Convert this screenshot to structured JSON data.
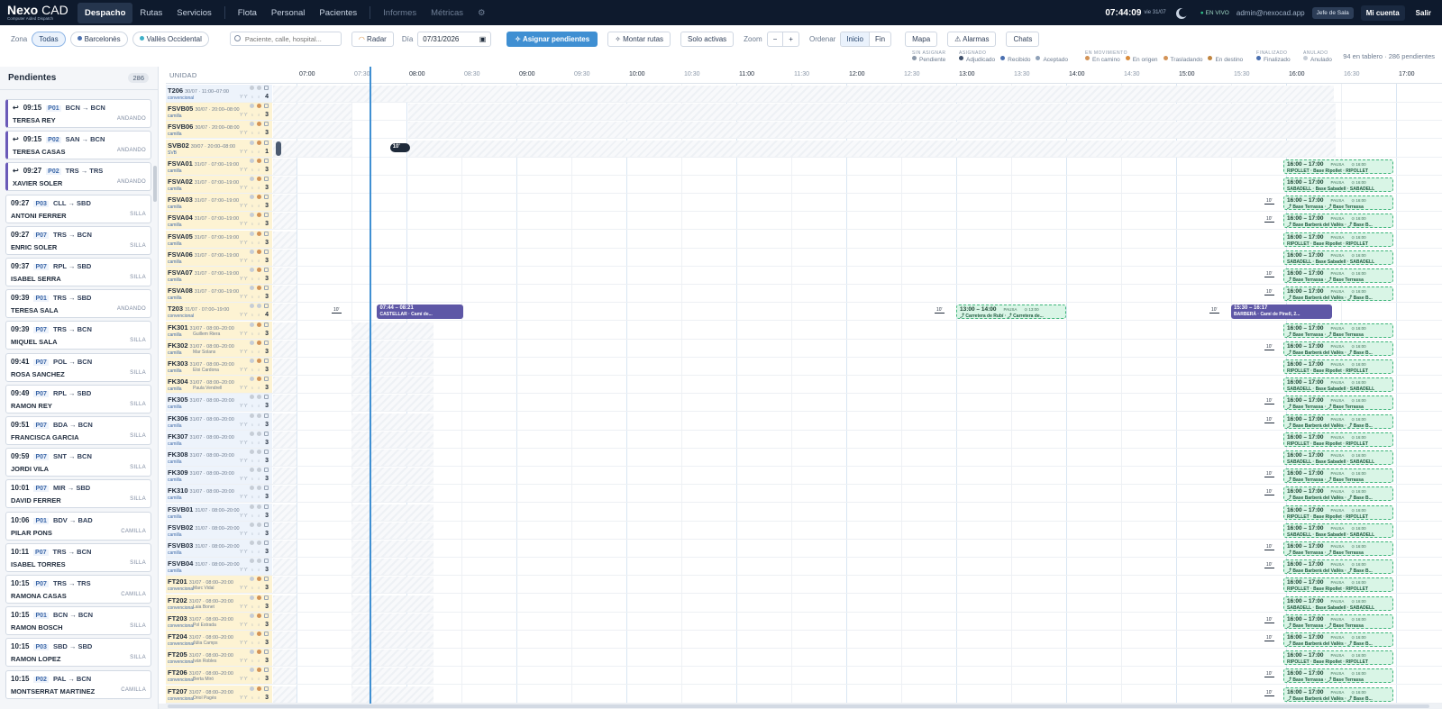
{
  "brand": {
    "name_bold": "Nexo",
    "name_light": " CAD",
    "subtitle": "Computer Aided Dispatch"
  },
  "nav": {
    "tabs": [
      {
        "label": "Despacho",
        "active": true
      },
      {
        "label": "Rutas"
      },
      {
        "label": "Servicios"
      },
      {
        "label": "Flota"
      },
      {
        "label": "Personal"
      },
      {
        "label": "Pacientes"
      },
      {
        "label": "Informes",
        "dim": true
      },
      {
        "label": "Métricas",
        "dim": true
      }
    ],
    "clock": "07:44:09",
    "date": "vie 31/07",
    "live": "EN VIVO",
    "user_email": "admin@nexocad.app",
    "role": "Jefe de Sala",
    "account": "Mi cuenta",
    "logout": "Salir"
  },
  "filters": {
    "zone_label": "Zona",
    "zones": [
      {
        "label": "Todas",
        "active": true
      },
      {
        "label": "Barcelonès",
        "color": "#4a6fb0"
      },
      {
        "label": "Vallès Occidental",
        "color": "#3fb0c8"
      }
    ],
    "search_placeholder": "Paciente, calle, hospital...",
    "radar": "Radar",
    "day_label": "Día",
    "date_value": "07/31/2026",
    "assign": "Asignar pendientes",
    "routes": "Montar rutas",
    "only_active": "Solo activas",
    "zoom_label": "Zoom",
    "zoom_minus": "−",
    "zoom_plus": "+",
    "order_label": "Ordenar",
    "order_start": "Inicio",
    "order_end": "Fin",
    "map": "Mapa",
    "alarms": "Alarmas",
    "chats": "Chats"
  },
  "legend": {
    "groups": [
      {
        "head": "SIN ASIGNAR",
        "items": [
          {
            "label": "Pendiente",
            "color": "#8a97a8"
          }
        ]
      },
      {
        "head": "ASIGNADO",
        "items": [
          {
            "label": "Adjudicado",
            "color": "#3e4f6a"
          },
          {
            "label": "Recibido",
            "color": "#4a6fb0"
          },
          {
            "label": "Aceptado",
            "color": "#8fa1b8"
          }
        ]
      },
      {
        "head": "EN MOVIMIENTO",
        "items": [
          {
            "label": "En camino",
            "color": "#d39357"
          },
          {
            "label": "En origen",
            "color": "#d98b3a"
          },
          {
            "label": "Trasladando",
            "color": "#d39357"
          },
          {
            "label": "En destino",
            "color": "#c0843f"
          }
        ]
      },
      {
        "head": "FINALIZADO",
        "items": [
          {
            "label": "Finalizado",
            "color": "#4a6fb0"
          }
        ]
      },
      {
        "head": "ANULADO",
        "items": [
          {
            "label": "Anulado",
            "color": "#c6cdd6"
          }
        ]
      }
    ],
    "counts": "94 en tablero · 286 pendientes"
  },
  "pending": {
    "title": "Pendientes",
    "count": "286",
    "cards": [
      {
        "time": "09:15",
        "prio": "P01",
        "route": "BCN → BCN",
        "name": "TERESA REY",
        "mode": "ANDANDO",
        "ret": true
      },
      {
        "time": "09:15",
        "prio": "P02",
        "route": "SAN → BCN",
        "name": "TERESA CASAS",
        "mode": "ANDANDO",
        "ret": true
      },
      {
        "time": "09:27",
        "prio": "P02",
        "route": "TRS → TRS",
        "name": "XAVIER SOLER",
        "mode": "ANDANDO",
        "ret": true
      },
      {
        "time": "09:27",
        "prio": "P03",
        "route": "CLL → SBD",
        "name": "ANTONI FERRER",
        "mode": "SILLA"
      },
      {
        "time": "09:27",
        "prio": "P07",
        "route": "TRS → BCN",
        "name": "ENRIC SOLER",
        "mode": "SILLA"
      },
      {
        "time": "09:37",
        "prio": "P07",
        "route": "RPL → SBD",
        "name": "ISABEL SERRA",
        "mode": "SILLA"
      },
      {
        "time": "09:39",
        "prio": "P01",
        "route": "TRS → SBD",
        "name": "TERESA SALA",
        "mode": "ANDANDO"
      },
      {
        "time": "09:39",
        "prio": "P07",
        "route": "TRS → BCN",
        "name": "MIQUEL SALA",
        "mode": "SILLA"
      },
      {
        "time": "09:41",
        "prio": "P07",
        "route": "POL → BCN",
        "name": "ROSA SANCHEZ",
        "mode": "SILLA"
      },
      {
        "time": "09:49",
        "prio": "P07",
        "route": "RPL → SBD",
        "name": "RAMON REY",
        "mode": "SILLA"
      },
      {
        "time": "09:51",
        "prio": "P07",
        "route": "BDA → BCN",
        "name": "FRANCISCA GARCIA",
        "mode": "SILLA"
      },
      {
        "time": "09:59",
        "prio": "P07",
        "route": "SNT → BCN",
        "name": "JORDI VILA",
        "mode": "SILLA"
      },
      {
        "time": "10:01",
        "prio": "P07",
        "route": "MIR → SBD",
        "name": "DAVID FERRER",
        "mode": "SILLA"
      },
      {
        "time": "10:06",
        "prio": "P01",
        "route": "BDV → BAD",
        "name": "PILAR PONS",
        "mode": "CAMILLA"
      },
      {
        "time": "10:11",
        "prio": "P07",
        "route": "TRS → BCN",
        "name": "ISABEL TORRES",
        "mode": "SILLA"
      },
      {
        "time": "10:15",
        "prio": "P07",
        "route": "TRS → TRS",
        "name": "RAMONA CASAS",
        "mode": "CAMILLA"
      },
      {
        "time": "10:15",
        "prio": "P01",
        "route": "BCN → BCN",
        "name": "RAMON BOSCH",
        "mode": "SILLA"
      },
      {
        "time": "10:15",
        "prio": "P03",
        "route": "SBD → SBD",
        "name": "RAMON LOPEZ",
        "mode": "SILLA"
      },
      {
        "time": "10:15",
        "prio": "P02",
        "route": "PAL → BCN",
        "name": "MONTSERRAT MARTINEZ",
        "mode": "CAMILLA"
      }
    ]
  },
  "timeline": {
    "unit_header": "UNIDAD",
    "ticks": [
      "07:00",
      "07:30",
      "08:00",
      "08:30",
      "09:00",
      "09:30",
      "10:00",
      "10:30",
      "11:00",
      "11:30",
      "12:00",
      "12:30",
      "13:00",
      "13:30",
      "14:00",
      "14:30",
      "15:00",
      "15:30",
      "16:00",
      "16:30",
      "17:00"
    ],
    "rows": [
      {
        "code": "T206",
        "shift": "30/07 · 11:00–07:00",
        "sub": "convencional",
        "num": "4",
        "bg": "blue"
      },
      {
        "code": "FSVB05",
        "shift": "30/07 · 20:00–08:00",
        "sub": "camilla",
        "num": "3",
        "bg": "yellow"
      },
      {
        "code": "FSVB06",
        "shift": "30/07 · 20:00–08:00",
        "sub": "camilla",
        "num": "3",
        "bg": "yellow"
      },
      {
        "code": "SVB02",
        "shift": "30/07 · 20:00–08:00",
        "sub": "SVB",
        "num": "1",
        "bg": "yellow"
      },
      {
        "code": "FSVA01",
        "shift": "31/07 · 07:00–19:00",
        "sub": "camilla",
        "num": "3",
        "bg": "yellow",
        "block": "ripollet"
      },
      {
        "code": "FSVA02",
        "shift": "31/07 · 07:00–19:00",
        "sub": "camilla",
        "num": "3",
        "bg": "yellow",
        "block": "sabadell"
      },
      {
        "code": "FSVA03",
        "shift": "31/07 · 07:00–19:00",
        "sub": "camilla",
        "num": "3",
        "bg": "yellow",
        "block": "terrassa",
        "gap": true
      },
      {
        "code": "FSVA04",
        "shift": "31/07 · 07:00–19:00",
        "sub": "camilla",
        "num": "3",
        "bg": "yellow",
        "block": "barbera",
        "gap": true
      },
      {
        "code": "FSVA05",
        "shift": "31/07 · 07:00–19:00",
        "sub": "camilla",
        "num": "3",
        "bg": "yellow",
        "block": "ripollet"
      },
      {
        "code": "FSVA06",
        "shift": "31/07 · 07:00–19:00",
        "sub": "camilla",
        "num": "3",
        "bg": "yellow",
        "block": "sabadell"
      },
      {
        "code": "FSVA07",
        "shift": "31/07 · 07:00–19:00",
        "sub": "camilla",
        "num": "3",
        "bg": "yellow",
        "block": "terrassa",
        "gap": true
      },
      {
        "code": "FSVA08",
        "shift": "31/07 · 07:00–19:00",
        "sub": "camilla",
        "num": "3",
        "bg": "yellow",
        "block": "barbera",
        "gap": true
      },
      {
        "code": "T203",
        "shift": "31/07 · 07:00–19:00",
        "sub": "convencional",
        "num": "4",
        "bg": "yellow",
        "special": true
      },
      {
        "code": "FK301",
        "shift": "31/07 · 08:00–20:00",
        "sub": "camilla",
        "crew": "Guillem Riera",
        "num": "3",
        "bg": "yellow",
        "block": "terrassa"
      },
      {
        "code": "FK302",
        "shift": "31/07 · 08:00–20:00",
        "sub": "camilla",
        "crew": "Mar Solans",
        "num": "3",
        "bg": "yellow",
        "block": "barbera",
        "gap": true
      },
      {
        "code": "FK303",
        "shift": "31/07 · 08:00–20:00",
        "sub": "camilla",
        "crew": "Eloi Cardona",
        "num": "3",
        "bg": "yellow",
        "block": "ripollet"
      },
      {
        "code": "FK304",
        "shift": "31/07 · 08:00–20:00",
        "sub": "camilla",
        "crew": "Paula Vendrell",
        "num": "3",
        "bg": "yellow",
        "block": "sabadell"
      },
      {
        "code": "FK305",
        "shift": "31/07 · 08:00–20:00",
        "sub": "camilla",
        "num": "3",
        "bg": "blue",
        "block": "terrassa",
        "gap": true
      },
      {
        "code": "FK306",
        "shift": "31/07 · 08:00–20:00",
        "sub": "camilla",
        "num": "3",
        "bg": "blue",
        "block": "barbera",
        "gap": true
      },
      {
        "code": "FK307",
        "shift": "31/07 · 08:00–20:00",
        "sub": "camilla",
        "num": "3",
        "bg": "blue",
        "block": "ripollet"
      },
      {
        "code": "FK308",
        "shift": "31/07 · 08:00–20:00",
        "sub": "camilla",
        "num": "3",
        "bg": "blue",
        "block": "sabadell"
      },
      {
        "code": "FK309",
        "shift": "31/07 · 08:00–20:00",
        "sub": "camilla",
        "num": "3",
        "bg": "blue",
        "block": "terrassa",
        "gap": true
      },
      {
        "code": "FK310",
        "shift": "31/07 · 08:00–20:00",
        "sub": "camilla",
        "num": "3",
        "bg": "blue",
        "block": "barbera",
        "gap": true
      },
      {
        "code": "FSVB01",
        "shift": "31/07 · 08:00–20:00",
        "sub": "camilla",
        "num": "3",
        "bg": "blue",
        "block": "ripollet"
      },
      {
        "code": "FSVB02",
        "shift": "31/07 · 08:00–20:00",
        "sub": "camilla",
        "num": "3",
        "bg": "blue",
        "block": "sabadell"
      },
      {
        "code": "FSVB03",
        "shift": "31/07 · 08:00–20:00",
        "sub": "camilla",
        "num": "3",
        "bg": "blue",
        "block": "terrassa",
        "gap": true
      },
      {
        "code": "FSVB04",
        "shift": "31/07 · 08:00–20:00",
        "sub": "camilla",
        "num": "3",
        "bg": "blue",
        "block": "barbera",
        "gap": true
      },
      {
        "code": "FT201",
        "shift": "31/07 · 08:00–20:00",
        "sub": "convencional",
        "crew": "Marc Vidal",
        "num": "3",
        "bg": "yellow",
        "block": "ripollet"
      },
      {
        "code": "FT202",
        "shift": "31/07 · 08:00–20:00",
        "sub": "convencional",
        "crew": "Laia Bonet",
        "num": "3",
        "bg": "yellow",
        "block": "sabadell"
      },
      {
        "code": "FT203",
        "shift": "31/07 · 08:00–20:00",
        "sub": "convencional",
        "crew": "Pol Estrada",
        "num": "3",
        "bg": "yellow",
        "block": "terrassa",
        "gap": true
      },
      {
        "code": "FT204",
        "shift": "31/07 · 08:00–20:00",
        "sub": "convencional",
        "crew": "Júlia Camps",
        "num": "3",
        "bg": "yellow",
        "block": "barbera",
        "gap": true
      },
      {
        "code": "FT205",
        "shift": "31/07 · 08:00–20:00",
        "sub": "convencional",
        "crew": "Iván Robles",
        "num": "3",
        "bg": "yellow",
        "block": "ripollet"
      },
      {
        "code": "FT206",
        "shift": "31/07 · 08:00–20:00",
        "sub": "convencional",
        "crew": "Berta Miró",
        "num": "3",
        "bg": "yellow",
        "block": "terrassa",
        "gap": true
      },
      {
        "code": "FT207",
        "shift": "31/07 · 08:00–20:00",
        "sub": "convencional",
        "crew": "Oriol Pagès",
        "num": "3",
        "bg": "yellow",
        "block": "barbera",
        "gap": true
      }
    ],
    "blocks": {
      "ripollet": {
        "time": "16:00 – 17:00",
        "pause": "PAUSA",
        "start": "⊙ 16:00",
        "l2": "RIPOLLET · Base Ripollet · RIPOLLET"
      },
      "sabadell": {
        "time": "16:00 – 17:00",
        "pause": "PAUSA",
        "start": "⊙ 16:00",
        "l2": "SABADELL · Base Sabadell · SABADELL"
      },
      "terrassa": {
        "time": "16:00 – 17:00",
        "pause": "PAUSA",
        "start": "⊙ 16:00",
        "l2": "⤴ Base Terrassa · ⤴ Base Terrassa"
      },
      "barbera": {
        "time": "16:00 – 17:00",
        "pause": "PAUSA",
        "start": "⊙ 16:00",
        "l2": "⤴ Base Barberà del Vallès · ⤴ Base B..."
      }
    },
    "gap_label": "10'",
    "svb_badge": "10'",
    "t203": {
      "trip1_time": "07:44 – 08:21",
      "trip1_place": "CASTELLAR · Camí de...",
      "pause_time": "13:00 – 14:00",
      "pause_label": "PAUSA",
      "pause_start": "⊙ 13:00",
      "pause_place": "⤴ Carretera de Rubí · ⤴ Carretera de...",
      "trip2_time": "15:30 – 16:17",
      "trip2_place": "BARBERÀ · Camí de Pinell, 2..."
    }
  }
}
